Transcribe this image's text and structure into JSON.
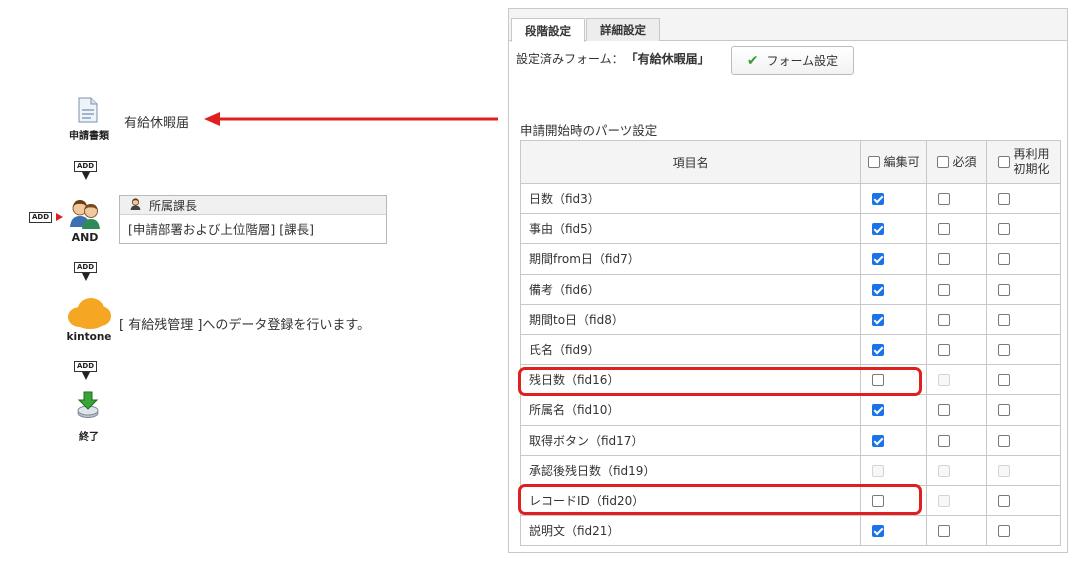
{
  "workflow": {
    "start_label": "申請書類",
    "form_name": "有給休暇届",
    "add_label": "ADD",
    "approver": {
      "title": "所属課長",
      "detail": "[申請部署および上位階層] [課長]",
      "mode_label": "AND"
    },
    "kintone": {
      "label": "kintone",
      "text": "[ 有給残管理 ]へのデータ登録を行います。"
    },
    "end_label": "終了"
  },
  "tabs": [
    {
      "label": "段階設定",
      "active": true
    },
    {
      "label": "詳細設定",
      "active": false
    }
  ],
  "form_setting": {
    "prefix": "設定済みフォーム：",
    "form_name": "「有給休暇届」",
    "button_label": "フォーム設定"
  },
  "parts": {
    "title": "申請開始時のパーツ設定",
    "headers": {
      "name": "項目名",
      "editable": "編集可",
      "required": "必須",
      "reuse_line1": "再利用",
      "reuse_line2": "初期化"
    },
    "rows": [
      {
        "name": "日数（fid3）",
        "editable": "checked",
        "required": "unchecked",
        "reuse": "unchecked"
      },
      {
        "name": "事由（fid5）",
        "editable": "checked",
        "required": "unchecked",
        "reuse": "unchecked"
      },
      {
        "name": "期間from日（fid7）",
        "editable": "checked",
        "required": "unchecked",
        "reuse": "unchecked"
      },
      {
        "name": "備考（fid6）",
        "editable": "checked",
        "required": "unchecked",
        "reuse": "unchecked"
      },
      {
        "name": "期間to日（fid8）",
        "editable": "checked",
        "required": "unchecked",
        "reuse": "unchecked"
      },
      {
        "name": "氏名（fid9）",
        "editable": "checked",
        "required": "unchecked",
        "reuse": "unchecked"
      },
      {
        "name": "残日数（fid16）",
        "editable": "unchecked",
        "required": "disabled",
        "reuse": "unchecked"
      },
      {
        "name": "所属名（fid10）",
        "editable": "checked",
        "required": "unchecked",
        "reuse": "unchecked"
      },
      {
        "name": "取得ボタン（fid17）",
        "editable": "checked",
        "required": "unchecked",
        "reuse": "unchecked"
      },
      {
        "name": "承認後残日数（fid19）",
        "editable": "disabled",
        "required": "disabled",
        "reuse": "disabled"
      },
      {
        "name": "レコードID（fid20）",
        "editable": "unchecked",
        "required": "disabled",
        "reuse": "unchecked"
      },
      {
        "name": "説明文（fid21）",
        "editable": "checked",
        "required": "unchecked",
        "reuse": "unchecked"
      }
    ]
  },
  "colors": {
    "highlight": "#e02020",
    "checkbox_checked": "#1a73e8",
    "kintone_orange": "#f5a623"
  }
}
